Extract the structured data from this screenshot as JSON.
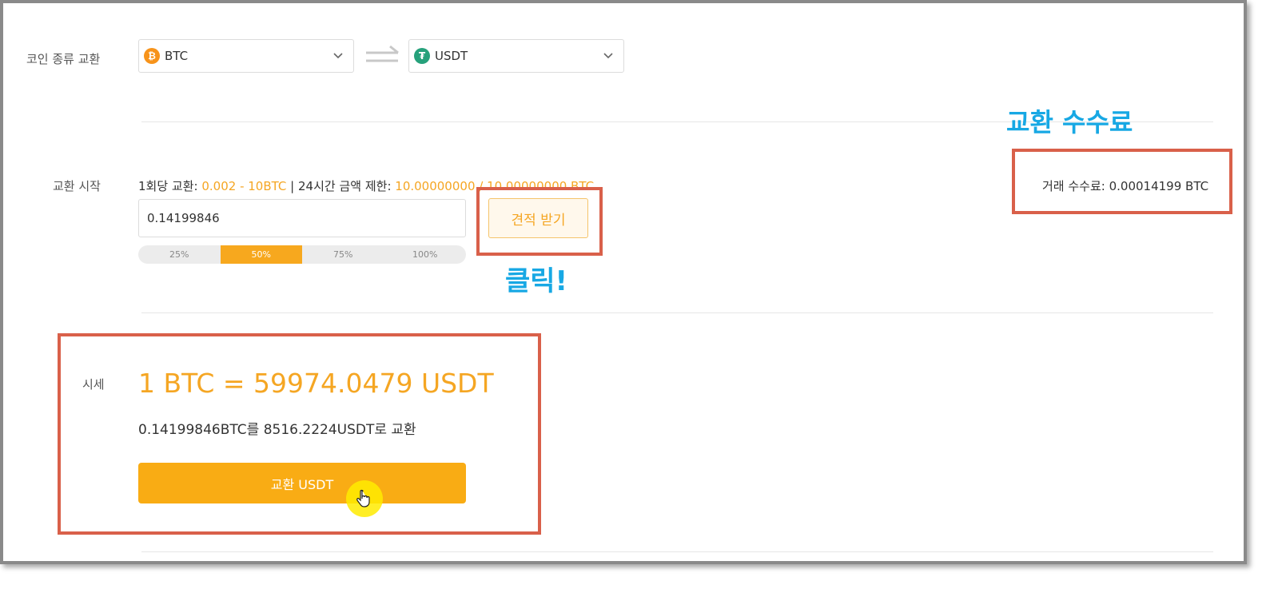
{
  "swap": {
    "label": "코인 종류 교환",
    "from_coin": "BTC",
    "from_icon": "bitcoin-icon",
    "to_coin": "USDT",
    "to_icon": "tether-icon"
  },
  "start": {
    "label": "교환 시작",
    "per_exchange_label": "1회당 교환:",
    "per_exchange_value": "0.002 - 10BTC",
    "separator": "|",
    "limit_label": "24시간 금액 제한:",
    "limit_value": "10.00000000 / 10.00000000 BTC",
    "amount": "0.14199846",
    "percents": [
      "25%",
      "50%",
      "75%",
      "100%"
    ],
    "active_percent_index": 1,
    "quote_button": "견적 받기"
  },
  "fee": {
    "label": "거래 수수료:",
    "value": "0.00014199 BTC"
  },
  "price": {
    "label": "시세",
    "rate": "1 BTC = 59974.0479 USDT",
    "summary": "0.14199846BTC를 8516.2224USDT로 교환",
    "exchange_button": "교환 USDT"
  },
  "annotations": {
    "fee_title": "교환 수수료",
    "click": "클릭!"
  },
  "colors": {
    "accent": "#f5a623",
    "button": "#f9ac14",
    "annotation_box": "#d9604a",
    "annotation_text": "#17a8e4",
    "bitcoin": "#f7931a",
    "tether": "#26a17b"
  }
}
